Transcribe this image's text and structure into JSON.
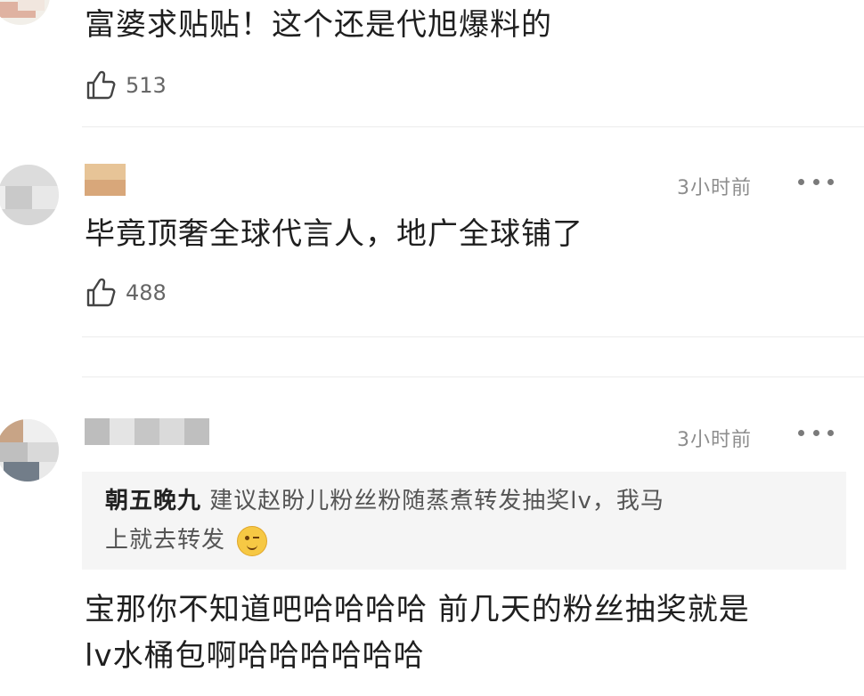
{
  "comments": [
    {
      "text": "富婆求贴贴！这个还是代旭爆料的",
      "likes": "513"
    },
    {
      "time": "3小时前",
      "text": "毕竟顶奢全球代言人，地广全球铺了",
      "likes": "488"
    },
    {
      "time": "3小时前",
      "reply": {
        "author": "朝五晚九",
        "line1": "建议赵盼儿粉丝粉随蒸煮转发抽奖lv，我马",
        "line2": "上就去转发"
      },
      "text_line1": "宝那你不知道吧哈哈哈哈 前几天的粉丝抽奖就是",
      "text_line2": "lv水桶包啊哈哈哈哈哈哈"
    }
  ],
  "icons": {
    "like": "thumbs-up-icon",
    "more": "more-dots-icon",
    "emoji": "wink-emoji-icon"
  },
  "colors": {
    "text": "#1f1f1f",
    "meta": "#8d8d8d",
    "reply_bg": "#f5f5f5"
  }
}
